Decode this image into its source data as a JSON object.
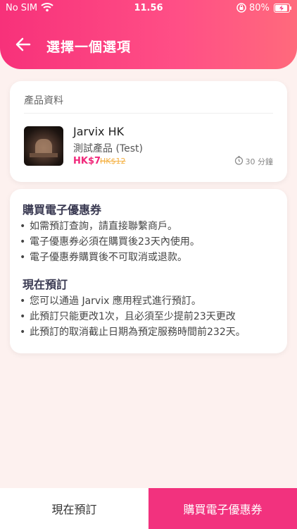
{
  "status_bar": {
    "carrier": "No SIM",
    "time": "11.56",
    "battery": "80%"
  },
  "header": {
    "title": "選擇一個選項"
  },
  "product": {
    "heading": "產品資料",
    "merchant": "Jarvix HK",
    "name": "測試產品 (Test)",
    "price": "HK$7",
    "original_price": "HK$12",
    "duration": "30 分鐘"
  },
  "voucher": {
    "title": "購買電子優惠券",
    "items": [
      "如需預訂查詢，請直接聯繫商戶。",
      "電子優惠券必須在購買後23天內使用。",
      "電子優惠券購買後不可取消或退款。"
    ]
  },
  "booking": {
    "title": "現在預訂",
    "items": [
      "您可以通過 Jarvix 應用程式進行預訂。",
      "此預訂只能更改1次，且必須至少提前23天更改",
      "此預訂的取消截止日期為預定服務時間前232天。"
    ]
  },
  "actions": {
    "book_now": "現在預訂",
    "buy_voucher": "購買電子優惠券"
  },
  "colors": {
    "accent": "#f2327e",
    "header_start": "#f7317a",
    "header_end": "#ff6a7c",
    "old_price": "#f5b040"
  }
}
